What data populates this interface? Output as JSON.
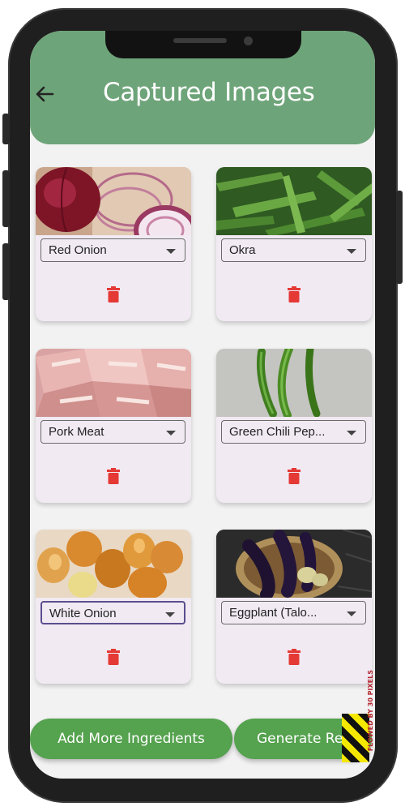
{
  "header": {
    "title": "Captured Images",
    "back_icon": "arrow-left-icon",
    "background": "#6ea479"
  },
  "ingredients": [
    {
      "label": "Red Onion",
      "image": "red-onion-photo"
    },
    {
      "label": "Okra",
      "image": "okra-photo"
    },
    {
      "label": "Pork Meat",
      "image": "pork-meat-photo"
    },
    {
      "label": "Green Chili Pep...",
      "image": "green-chili-photo"
    },
    {
      "label": "White Onion",
      "image": "white-onion-photo",
      "focused": true
    },
    {
      "label": "Eggplant (Talo...",
      "image": "eggplant-photo"
    }
  ],
  "delete_icon": "trash-icon",
  "delete_color": "#e53935",
  "buttons": {
    "add_more": "Add More Ingredients",
    "generate": "Generate Re",
    "color": "#55a24f"
  },
  "overflow_warning": "FLOWED BY 30 PIXELS"
}
